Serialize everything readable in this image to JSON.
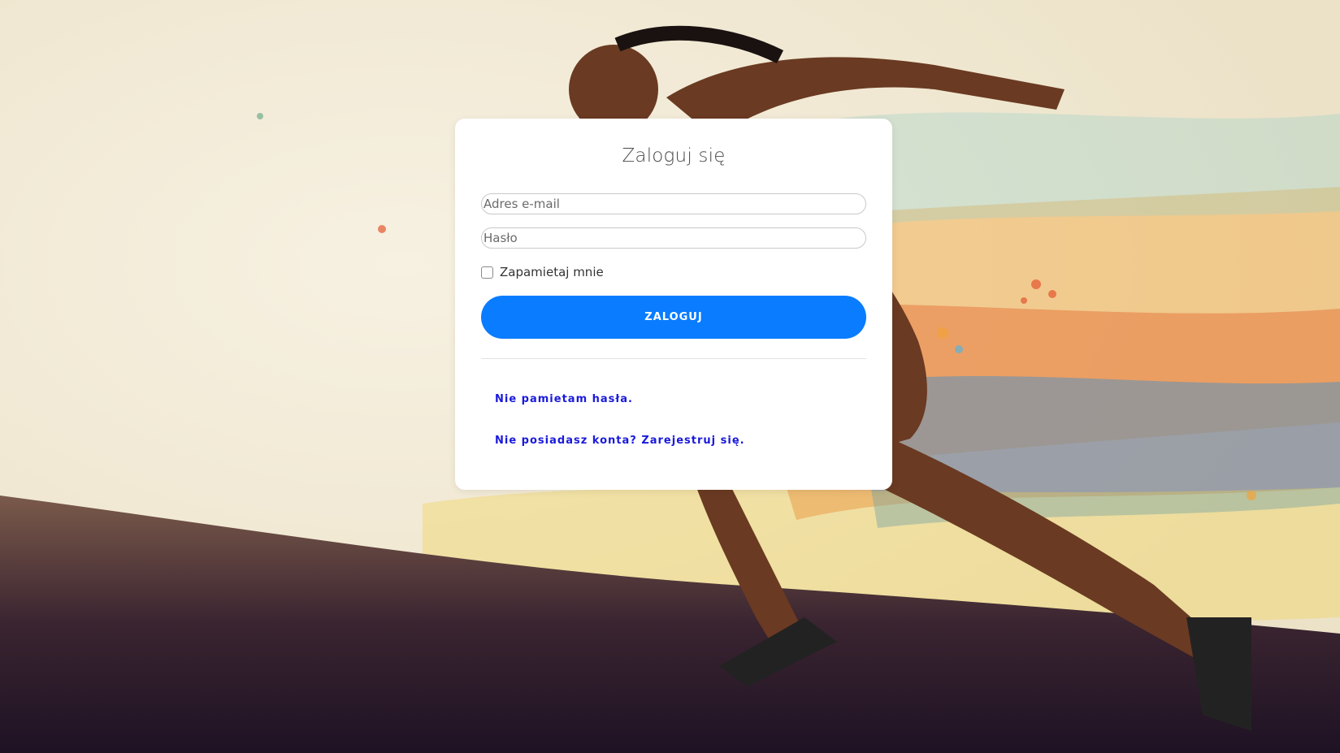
{
  "background": {
    "description_icon": "runner-illustration"
  },
  "login": {
    "title": "Zaloguj się",
    "email_placeholder": "Adres e-mail",
    "password_placeholder": "Hasło",
    "remember_label": "Zapamietaj mnie",
    "remember_checked": false,
    "submit_label": "ZALOGUJ",
    "forgot_link": "Nie pamietam hasła.",
    "register_link": "Nie posiadasz konta? Zarejestruj się."
  },
  "colors": {
    "primary": "#0a7cff",
    "link": "#1a1adc",
    "card": "#ffffff"
  }
}
